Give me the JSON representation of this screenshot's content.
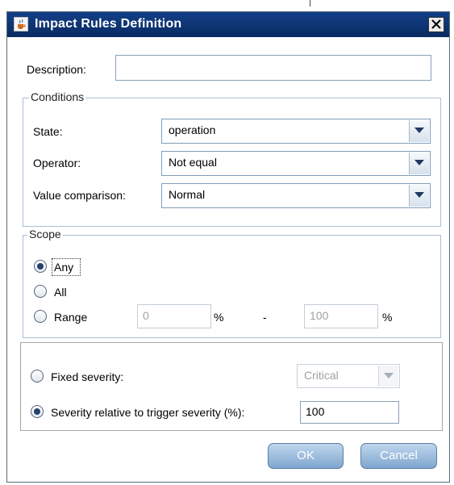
{
  "window": {
    "title": "Impact Rules Definition"
  },
  "description": {
    "label": "Description:",
    "value": ""
  },
  "conditions": {
    "legend": "Conditions",
    "state": {
      "label": "State:",
      "value": "operation"
    },
    "operator": {
      "label": "Operator:",
      "value": "Not equal"
    },
    "value_comparison": {
      "label": "Value comparison:",
      "value": "Normal"
    }
  },
  "scope": {
    "legend": "Scope",
    "any_label": "Any",
    "all_label": "All",
    "range_label": "Range",
    "selected": "Any",
    "range_from": "0",
    "range_to": "100",
    "percent_symbol": "%",
    "dash": "-"
  },
  "severity": {
    "fixed_label": "Fixed severity:",
    "fixed_value": "Critical",
    "relative_label": "Severity relative to trigger severity (%):",
    "relative_value": "100",
    "selected": "relative"
  },
  "buttons": {
    "ok": "OK",
    "cancel": "Cancel"
  },
  "colors": {
    "titlebar": "#0a2b62",
    "button": "#8fb3d9",
    "group_border": "#a8bfd4"
  },
  "icons": {
    "app": "java-cup-icon",
    "close": "close-icon",
    "dropdown": "chevron-down-icon"
  }
}
